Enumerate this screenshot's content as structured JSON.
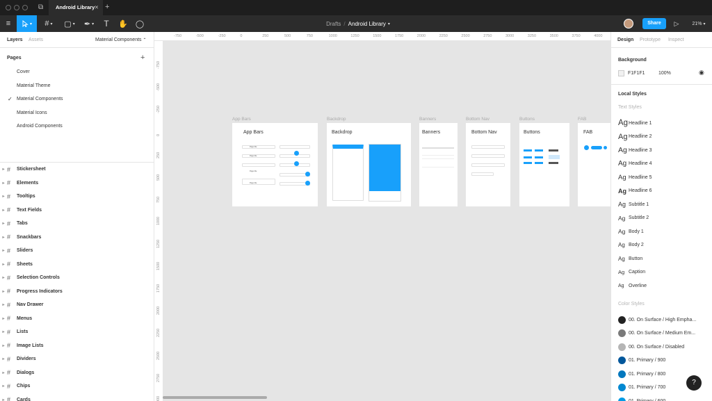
{
  "window": {
    "tab_title": "Android Library",
    "new_tab": "+"
  },
  "toolbar": {
    "breadcrumb_parent": "Drafts",
    "breadcrumb_sep": "/",
    "file_name": "Android Library",
    "share_label": "Share",
    "zoom": "21%",
    "accent": "#18a0fb"
  },
  "left_panel": {
    "tabs": [
      "Layers",
      "Assets"
    ],
    "current_page_select": "Material Components",
    "pages_title": "Pages",
    "add_page": "+",
    "pages": [
      "Cover",
      "Material Theme",
      "Material Components",
      "Material Icons",
      "Android Components"
    ],
    "selected_page_index": 2,
    "layers": [
      "Stickersheet",
      "Elements",
      "Tooltips",
      "Text Fields",
      "Tabs",
      "Snackbars",
      "Sliders",
      "Sheets",
      "Selection Controls",
      "Progress Indicators",
      "Nav Drawer",
      "Menus",
      "Lists",
      "Image Lists",
      "Dividers",
      "Dialogs",
      "Chips",
      "Cards"
    ]
  },
  "right_panel": {
    "tabs": [
      "Design",
      "Prototype",
      "Inspect"
    ],
    "background_title": "Background",
    "background_hex": "F1F1F1",
    "background_opacity": "100%",
    "local_styles_title": "Local Styles",
    "text_styles_title": "Text Styles",
    "text_styles": [
      "Headline 1",
      "Headline 2",
      "Headline 3",
      "Headline 4",
      "Headline 5",
      "Headline 6",
      "Subtitle 1",
      "Subtitle 2",
      "Body 1",
      "Body 2",
      "Button",
      "Caption",
      "Overline"
    ],
    "ag": "Ag",
    "color_styles_title": "Color Styles",
    "color_styles": [
      {
        "name": "00. On Surface / High Empha...",
        "color": "#222222"
      },
      {
        "name": "00. On Surface / Medium Em...",
        "color": "#7a7a7a"
      },
      {
        "name": "00. On Surface / Disabled",
        "color": "#b5b5b5"
      },
      {
        "name": "01. Primary / 900",
        "color": "#01579b"
      },
      {
        "name": "01. Primary / 800",
        "color": "#0277bd"
      },
      {
        "name": "01. Primary / 700",
        "color": "#0288d1"
      },
      {
        "name": "01. Primary / 600",
        "color": "#039be5"
      }
    ]
  },
  "canvas": {
    "ruler_x": [
      "-750",
      "-500",
      "-250",
      "0",
      "250",
      "500",
      "750",
      "1000",
      "1250",
      "1500",
      "1750",
      "2000",
      "2250",
      "2500",
      "2750",
      "3000",
      "3250",
      "3500",
      "3750",
      "4000"
    ],
    "ruler_y": [
      "-750",
      "-500",
      "-250",
      "0",
      "250",
      "500",
      "750",
      "1000",
      "1250",
      "1500",
      "1750",
      "2000",
      "2250",
      "2500",
      "2750",
      "3000"
    ],
    "frames": [
      {
        "label": "App Bars",
        "title": "App Bars"
      },
      {
        "label": "Backdrop",
        "title": "Backdrop"
      },
      {
        "label": "Banners",
        "title": "Banners"
      },
      {
        "label": "Bottom Nav",
        "title": "Bottom Nav"
      },
      {
        "label": "Buttons",
        "title": "Buttons"
      },
      {
        "label": "FAB",
        "title": "FAB"
      }
    ],
    "page_title_text": "Page title"
  },
  "help": "?"
}
